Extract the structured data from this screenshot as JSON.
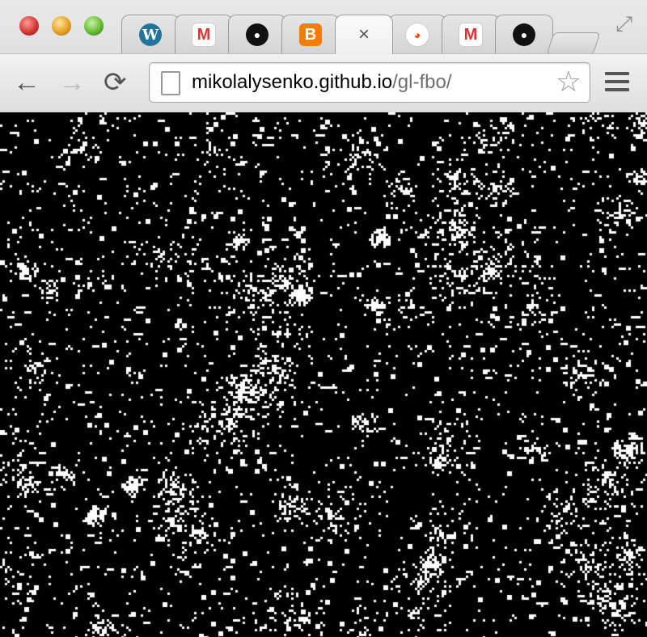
{
  "browser": {
    "tabs": [
      {
        "icon": "wordpress-icon",
        "glyph": "W"
      },
      {
        "icon": "gmail-icon",
        "glyph": "M"
      },
      {
        "icon": "github-icon",
        "glyph": "●"
      },
      {
        "icon": "blogger-icon",
        "glyph": "B"
      },
      {
        "icon": "close-icon",
        "glyph": "×",
        "active": true
      },
      {
        "icon": "reddit-icon",
        "glyph": "◕"
      },
      {
        "icon": "gmail-icon",
        "glyph": "M"
      },
      {
        "icon": "github-icon",
        "glyph": "●"
      }
    ],
    "url": {
      "host": "mikolalysenko.github.io",
      "path": "/gl-fbo/"
    }
  },
  "canvas": {
    "background": "#000000",
    "cell_color": "#ffffff"
  }
}
